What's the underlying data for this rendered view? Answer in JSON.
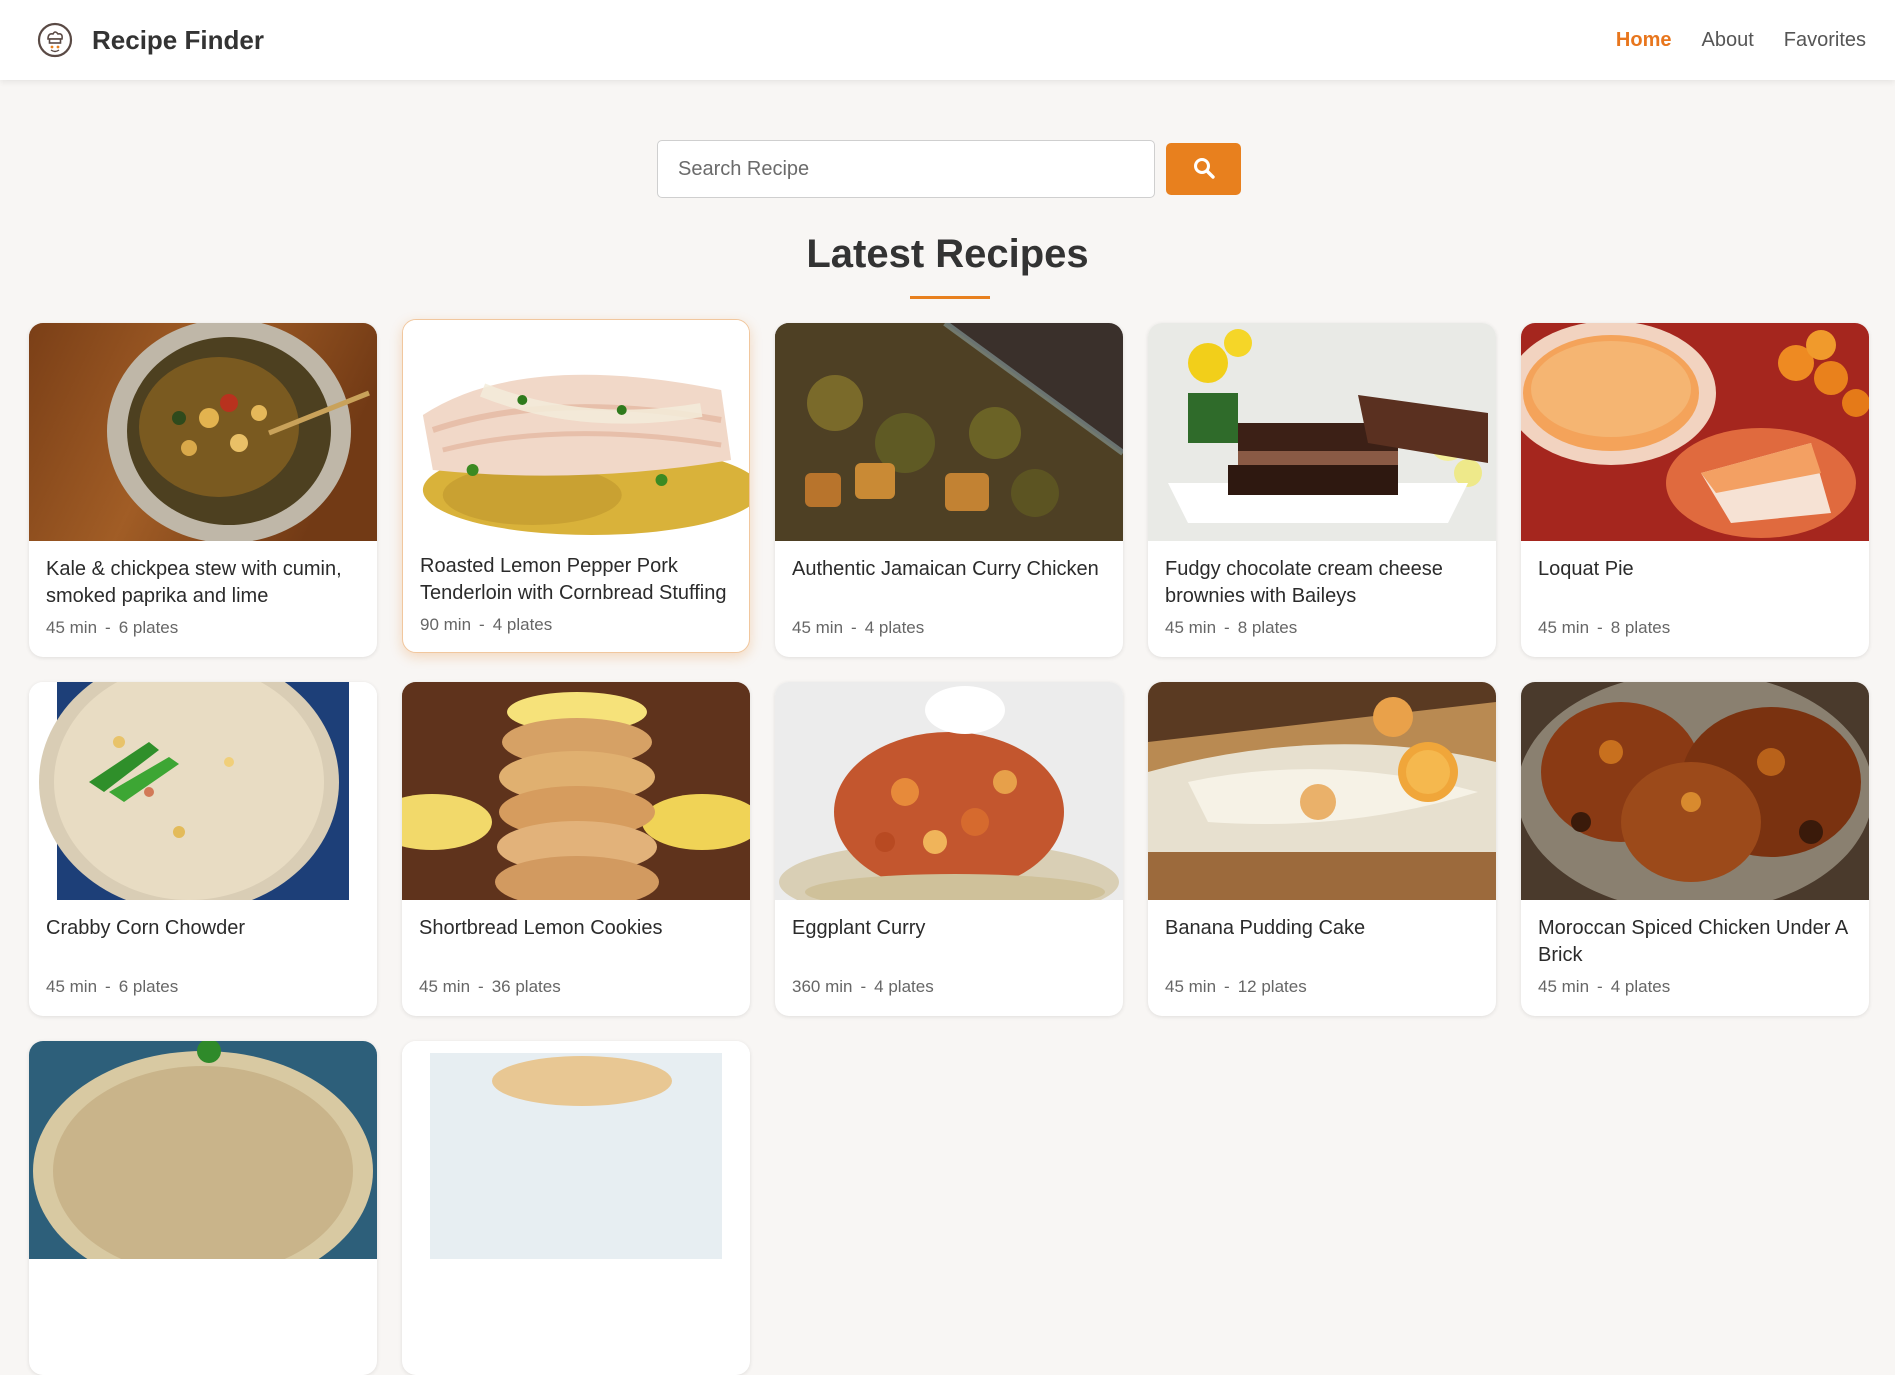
{
  "app": {
    "title": "Recipe Finder",
    "logo_icon": "chef-hat-icon"
  },
  "nav": {
    "items": [
      {
        "label": "Home",
        "active": true
      },
      {
        "label": "About",
        "active": false
      },
      {
        "label": "Favorites",
        "active": false
      }
    ]
  },
  "search": {
    "placeholder": "Search Recipe",
    "value": "",
    "button_icon": "search-icon"
  },
  "section": {
    "title": "Latest Recipes"
  },
  "meta_separator": "-",
  "recipes": [
    {
      "title": "Kale & chickpea stew with cumin, smoked paprika and lime",
      "time": "45 min",
      "servings": "6 plates",
      "image": "stew-bowl"
    },
    {
      "title": "Roasted Lemon Pepper Pork Tenderloin with Cornbread Stuffing",
      "time": "90 min",
      "servings": "4 plates",
      "image": "pork-tenderloin"
    },
    {
      "title": "Authentic Jamaican Curry Chicken",
      "time": "45 min",
      "servings": "4 plates",
      "image": "curry-chicken"
    },
    {
      "title": "Fudgy chocolate cream cheese brownies with Baileys",
      "time": "45 min",
      "servings": "8 plates",
      "image": "brownies"
    },
    {
      "title": "Loquat Pie",
      "time": "45 min",
      "servings": "8 plates",
      "image": "pie"
    },
    {
      "title": "Crabby Corn Chowder",
      "time": "45 min",
      "servings": "6 plates",
      "image": "chowder"
    },
    {
      "title": "Shortbread Lemon Cookies",
      "time": "45 min",
      "servings": "36 plates",
      "image": "cookies"
    },
    {
      "title": "Eggplant Curry",
      "time": "360 min",
      "servings": "4 plates",
      "image": "eggplant-curry"
    },
    {
      "title": "Banana Pudding Cake",
      "time": "45 min",
      "servings": "12 plates",
      "image": "banana-cake"
    },
    {
      "title": "Moroccan Spiced Chicken Under A Brick",
      "time": "45 min",
      "servings": "4 plates",
      "image": "roast-chicken"
    },
    {
      "title": "",
      "time": "",
      "servings": "",
      "image": "soup-partial"
    },
    {
      "title": "",
      "time": "",
      "servings": "",
      "image": "dish-partial"
    }
  ],
  "colors": {
    "accent": "#e8801e",
    "background": "#f8f6f4",
    "card": "#ffffff",
    "text": "#2b2b2b"
  }
}
